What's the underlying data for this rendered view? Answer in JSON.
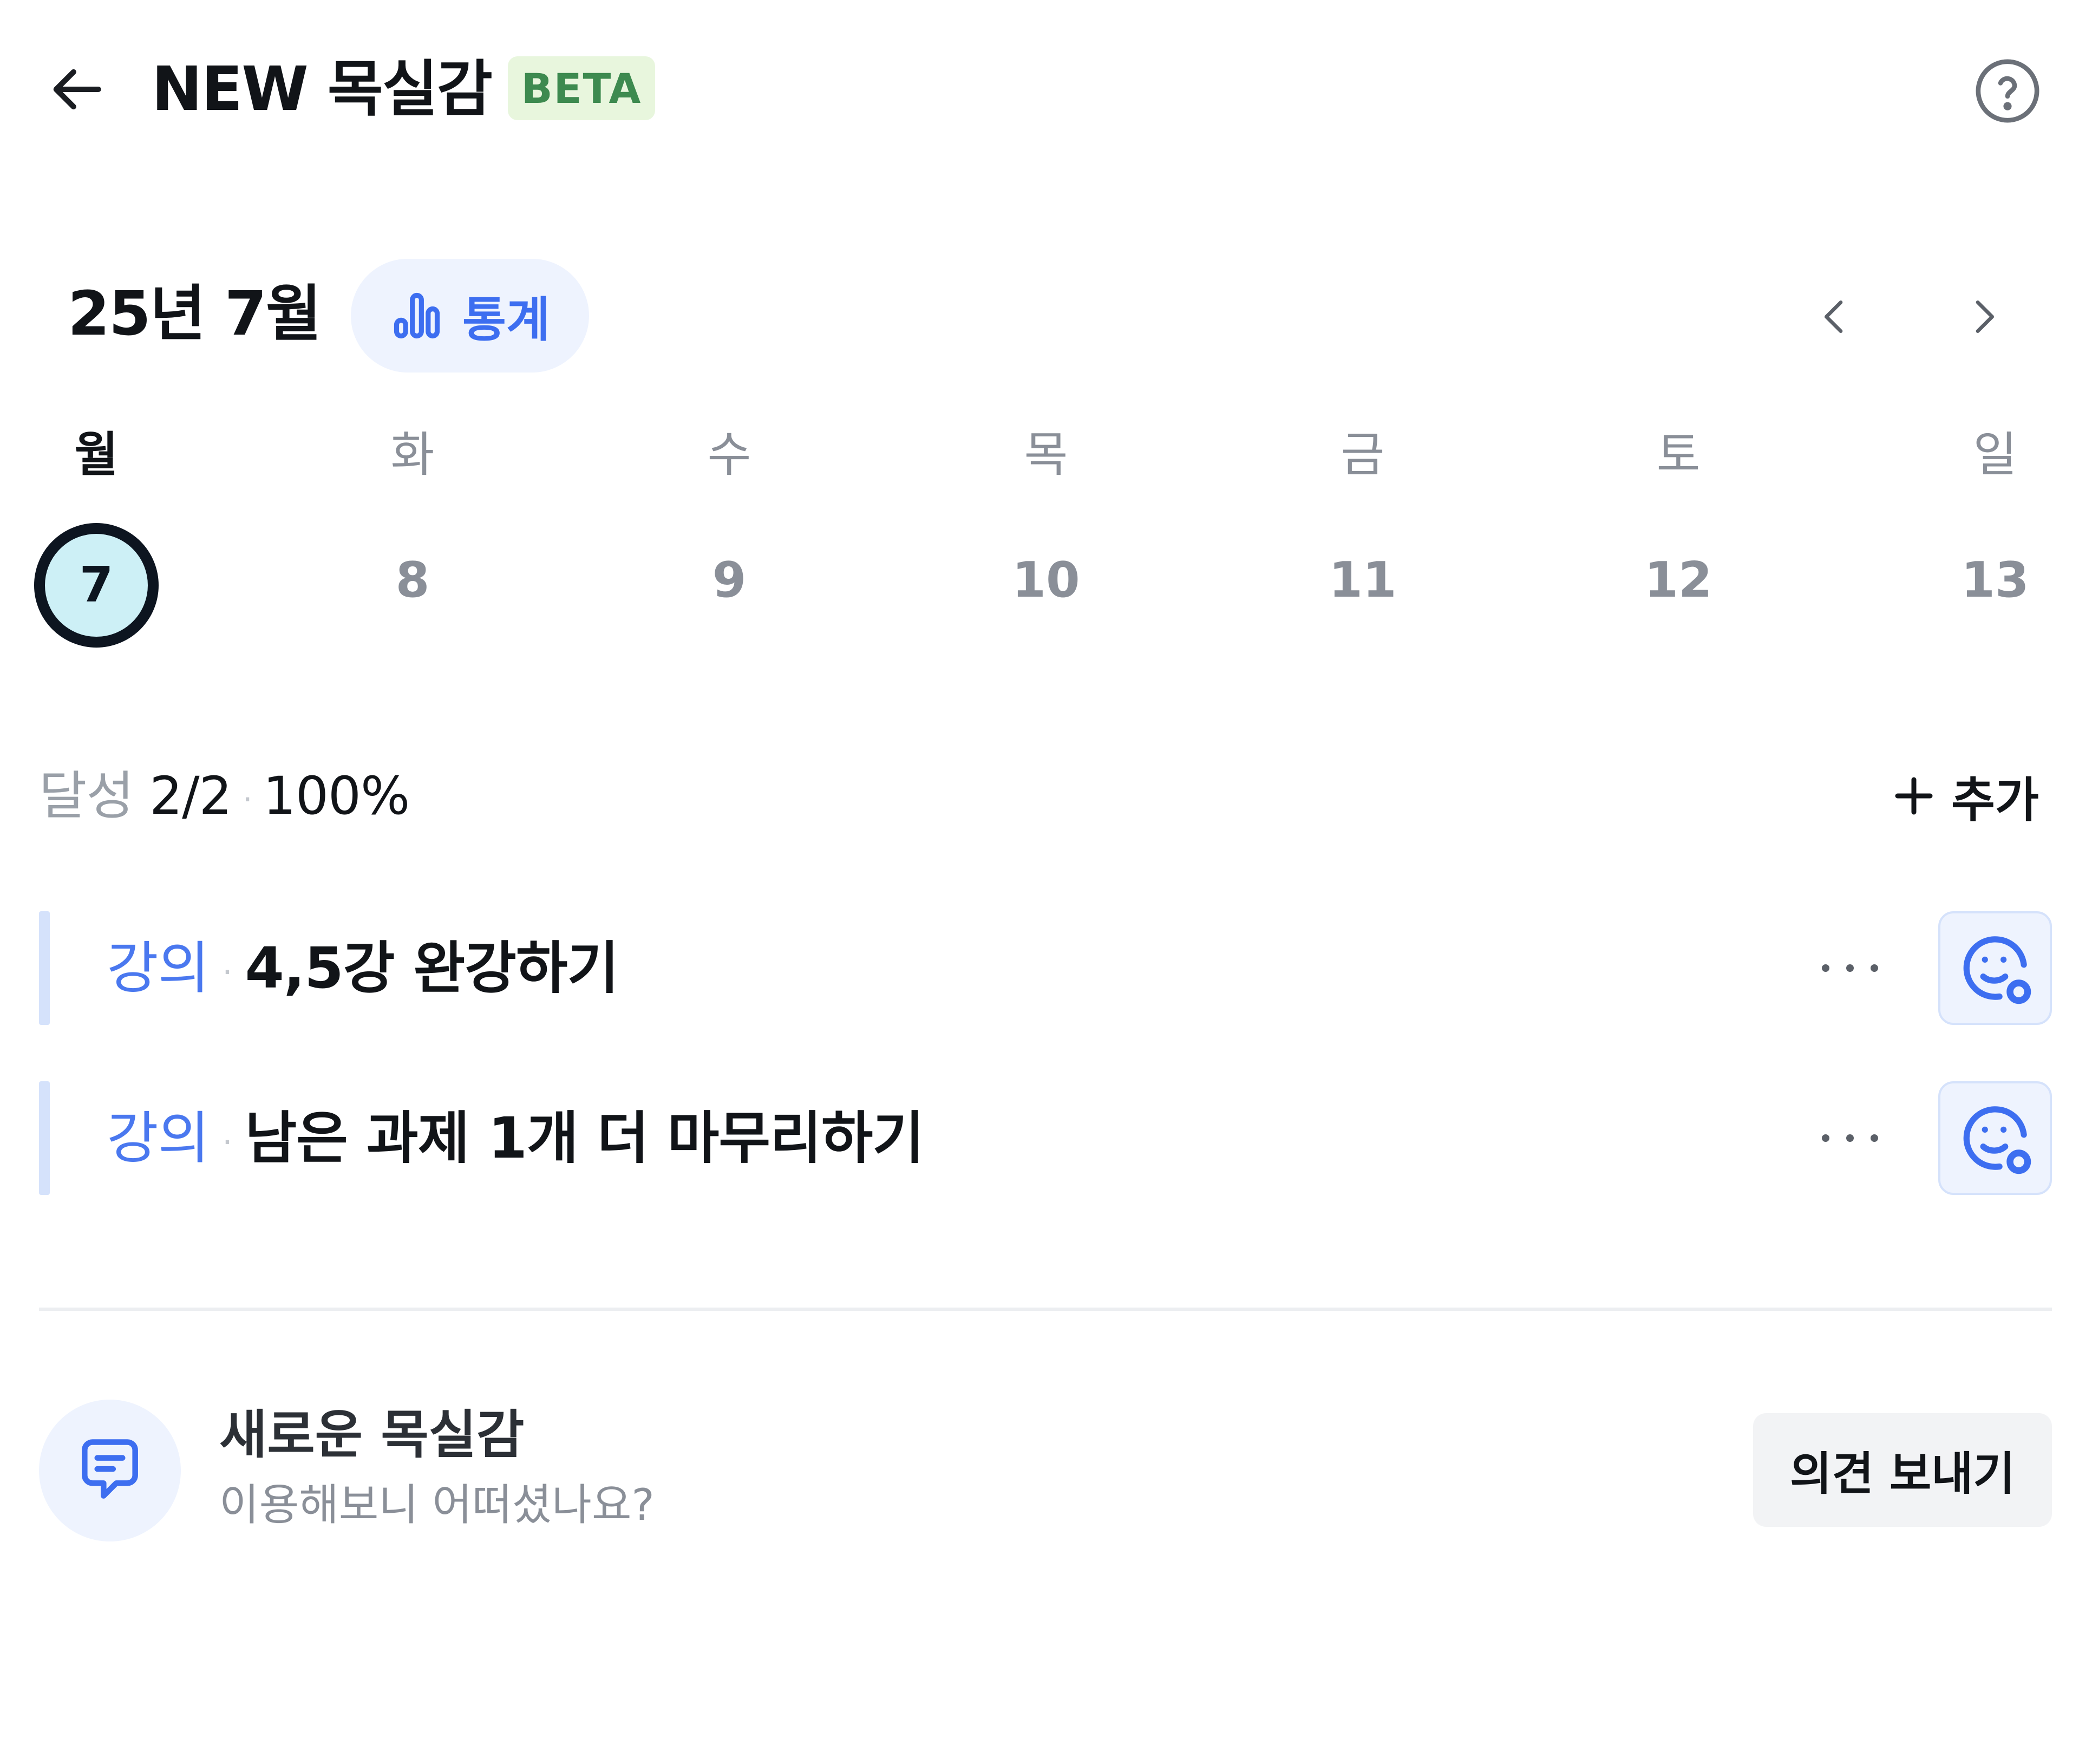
{
  "header": {
    "title": "NEW 목실감",
    "badge": "BETA",
    "back_icon": "arrow-left-icon",
    "help_icon": "question-circle-icon"
  },
  "calendar": {
    "month_label": "25년 7월",
    "stats_label": "통계",
    "stats_icon": "bar-chart-icon",
    "weekdays": [
      "월",
      "화",
      "수",
      "목",
      "금",
      "토",
      "일"
    ],
    "days": [
      "7",
      "8",
      "9",
      "10",
      "11",
      "12",
      "13"
    ],
    "selected_day": "7"
  },
  "progress": {
    "label": "달성",
    "count": "2/2",
    "separator": "·",
    "percent": "100%"
  },
  "add": {
    "label": "추가",
    "icon": "plus-icon"
  },
  "tasks": [
    {
      "category": "강의",
      "separator": "·",
      "title": "4,5강 완강하기",
      "more": "···"
    },
    {
      "category": "강의",
      "separator": "·",
      "title": "남은 과제 1개 더 마무리하기",
      "more": "···"
    }
  ],
  "feedback": {
    "title": "새로운 목실감",
    "subtitle": "이용해보니 어떠셨나요?",
    "button": "의견 보내기",
    "icon": "chat-bubble-icon"
  },
  "colors": {
    "accent": "#3d6ef0",
    "selected_day_fill": "#cdf0f6",
    "badge_bg": "#e8f6dd",
    "badge_text": "#3d8a4f"
  }
}
